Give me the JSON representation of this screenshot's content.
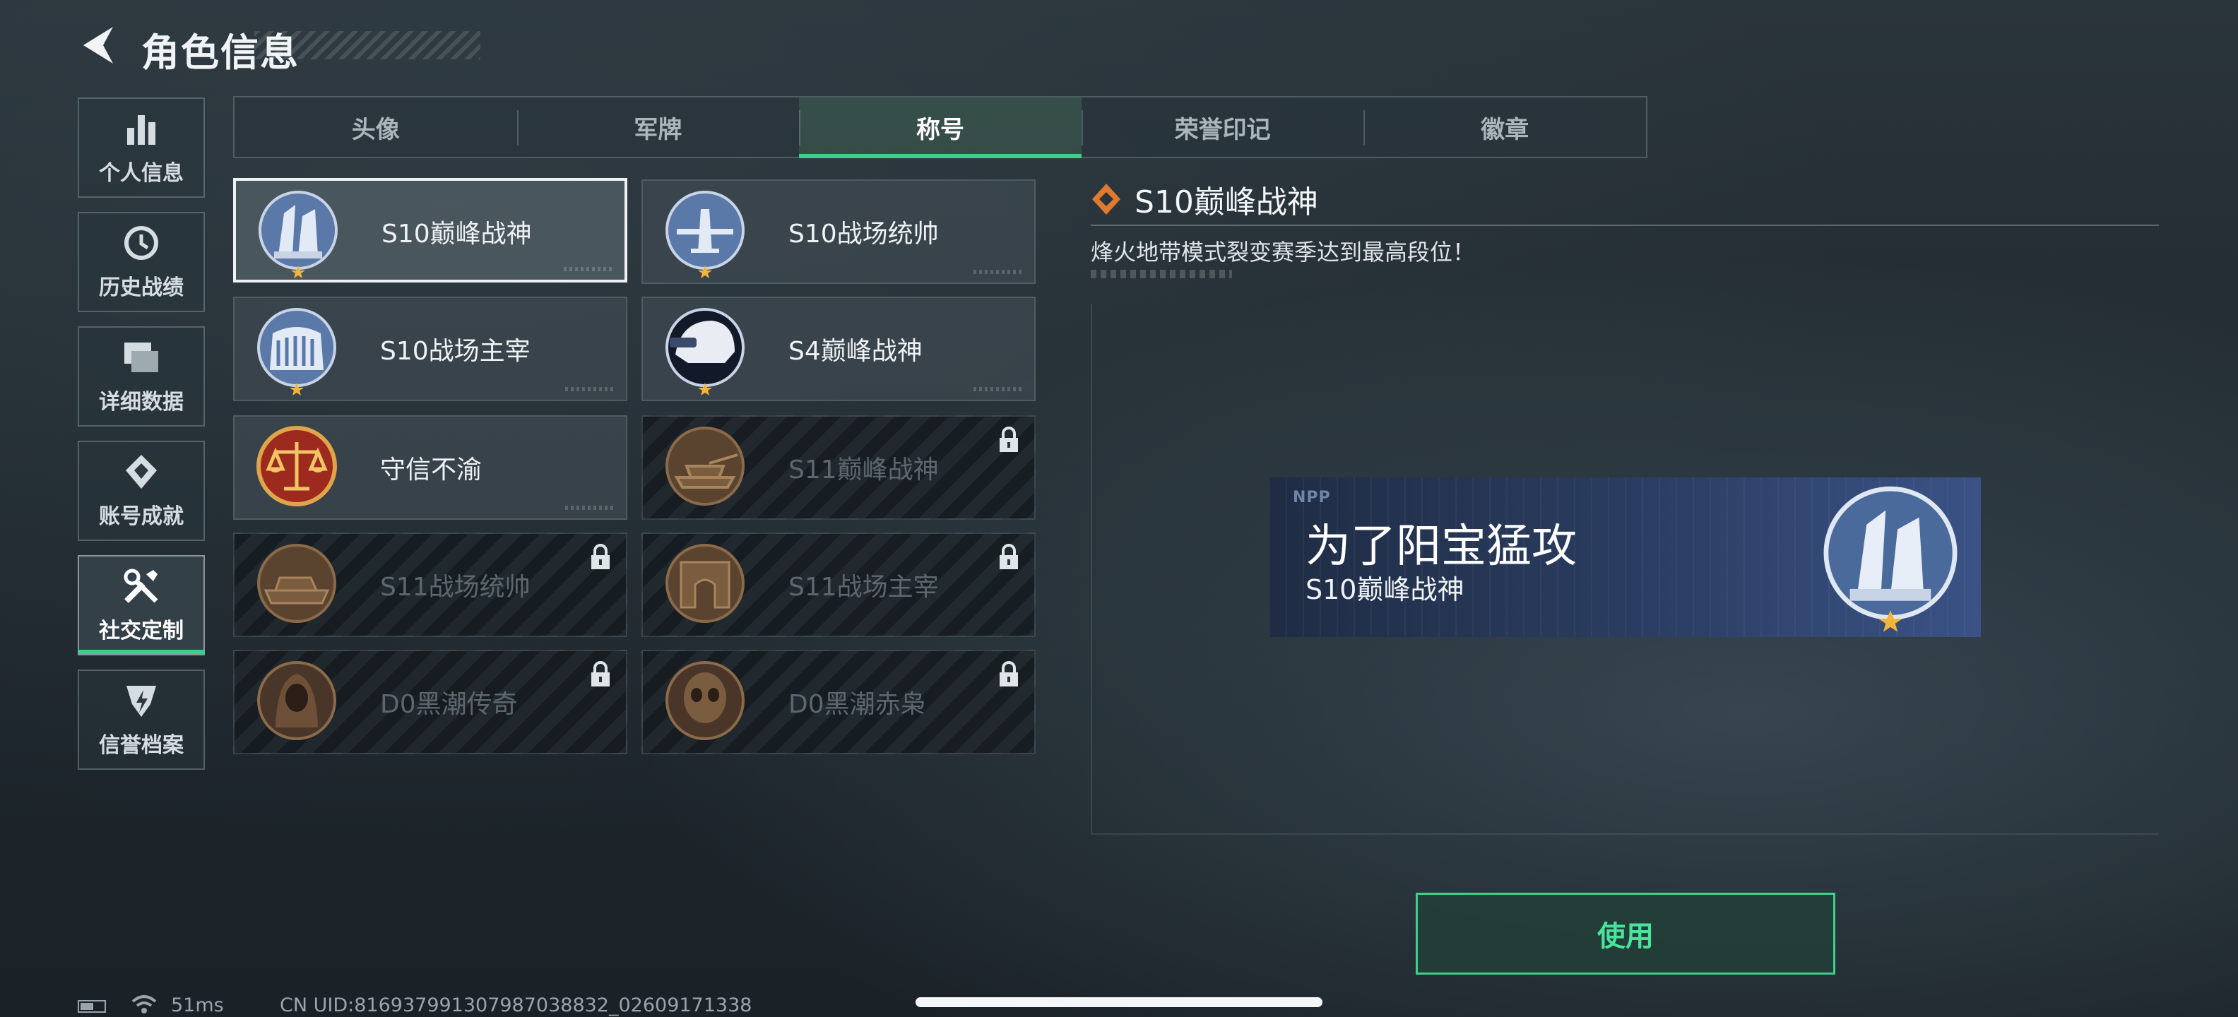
{
  "header": {
    "title": "角色信息",
    "back_icon": "back-arrow-icon"
  },
  "sidebar": {
    "items": [
      {
        "label": "个人信息",
        "icon": "bar-chart-icon"
      },
      {
        "label": "历史战绩",
        "icon": "history-clock-icon"
      },
      {
        "label": "详细数据",
        "icon": "cards-icon"
      },
      {
        "label": "账号成就",
        "icon": "achievement-icon"
      },
      {
        "label": "社交定制",
        "icon": "tools-icon",
        "active": true
      },
      {
        "label": "信誉档案",
        "icon": "shield-bolt-icon"
      }
    ]
  },
  "tabs": [
    {
      "label": "头像"
    },
    {
      "label": "军牌"
    },
    {
      "label": "称号",
      "active": true
    },
    {
      "label": "荣誉印记"
    },
    {
      "label": "徽章"
    }
  ],
  "titles": [
    {
      "name": "S10巅峰战神",
      "selected": true,
      "locked": false,
      "icon": "tower-medal-icon"
    },
    {
      "name": "S10战场统帅",
      "locked": false,
      "icon": "aircraft-medal-icon"
    },
    {
      "name": "S10战场主宰",
      "locked": false,
      "icon": "colosseum-medal-icon"
    },
    {
      "name": "S4巅峰战神",
      "locked": false,
      "icon": "helmet-medal-icon"
    },
    {
      "name": "守信不渝",
      "locked": false,
      "icon": "scales-medal-icon"
    },
    {
      "name": "S11巅峰战神",
      "locked": true,
      "icon": "tank-medal-icon"
    },
    {
      "name": "S11战场统帅",
      "locked": true,
      "icon": "armored-vehicle-medal-icon"
    },
    {
      "name": "S11战场主宰",
      "locked": true,
      "icon": "arch-medal-icon"
    },
    {
      "name": "D0黑潮传奇",
      "locked": true,
      "icon": "hooded-figure-medal-icon"
    },
    {
      "name": "D0黑潮赤枭",
      "locked": true,
      "icon": "skull-mask-medal-icon"
    }
  ],
  "detail": {
    "title": "S10巅峰战神",
    "description": "烽火地带模式裂变赛季达到最高段位！",
    "banner": {
      "player_name": "为了阳宝猛攻",
      "title": "S10巅峰战神",
      "logo": "NPP"
    }
  },
  "use_button": {
    "label": "使用"
  },
  "status": {
    "ping": "51ms",
    "uid": "CN UID:816937991307987038832_02609171338"
  },
  "colors": {
    "accent": "#3ed08a",
    "background": "#1f282e",
    "locked_text": "#5c676e"
  }
}
